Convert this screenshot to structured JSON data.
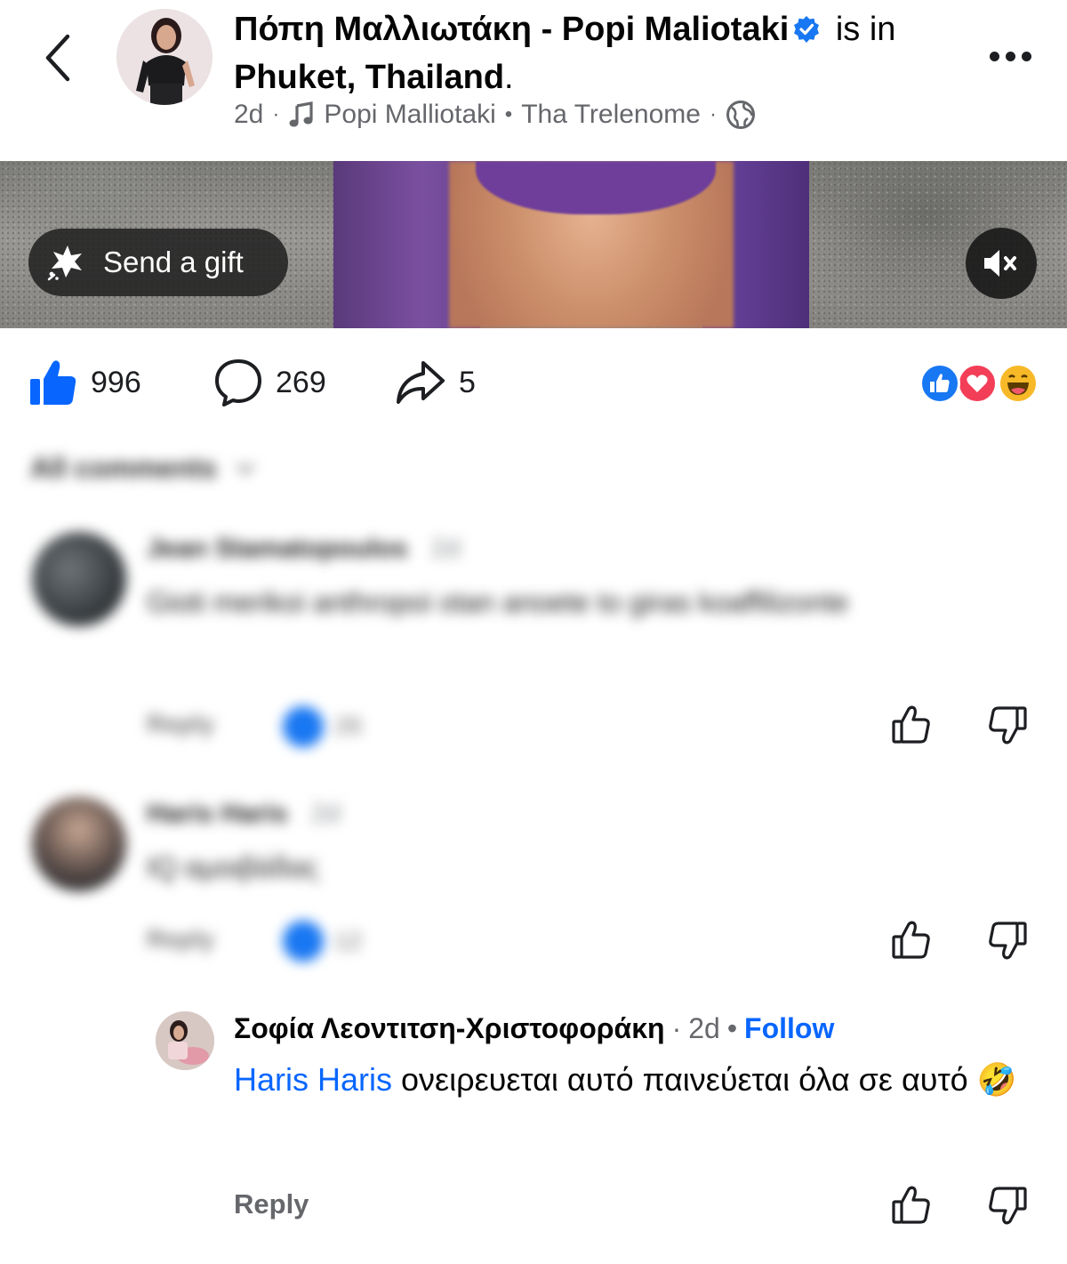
{
  "header": {
    "author_greek": "Πόπη Μαλλιωτάκη",
    "author_separator": "-",
    "author_latin": "Popi Maliotaki",
    "is_in": "is in",
    "location": "Phuket, Thailand",
    "period": ".",
    "time": "2d",
    "song_artist": "Popi Malliotaki",
    "song_title": "Tha Trelenome",
    "meta_dot": "·",
    "song_dot": "•"
  },
  "media": {
    "gift_label": "Send a gift"
  },
  "actions": {
    "likes": "996",
    "comments": "269",
    "shares": "5"
  },
  "comments_filter": {
    "label": "All comments"
  },
  "comments": [
    {
      "name": "Jean Stamatopoulos",
      "time": "2d",
      "text": "Gioti merikoi anthropoi otan anoete to giras koaffilizonte",
      "reply_label": "Reply",
      "like_count": "26"
    },
    {
      "name": "Haris Haris",
      "time": "2d",
      "text": "IQ αμοιβάδας",
      "reply_label": "Reply",
      "like_count": "12"
    }
  ],
  "reply": {
    "name": "Σοφία Λεοντιτση-Χριστοφοράκη",
    "dot": "·",
    "time": "2d",
    "dot2": "•",
    "follow_label": "Follow",
    "mention": "Haris Haris",
    "text": "ονειρευεται αυτό παινεύεται όλα σε αυτό",
    "emoji": "🤣",
    "reply_label": "Reply"
  },
  "colors": {
    "brand_blue": "#0866ff",
    "like_blue": "#1877f2",
    "love_red": "#f33e58",
    "haha_yellow": "#f7b928",
    "secondary_text": "#65676b"
  },
  "icons": [
    "back-arrow-icon",
    "verified-badge-icon",
    "music-note-icon",
    "globe-icon",
    "more-dots-icon",
    "gift-icon",
    "mute-icon",
    "like-icon",
    "comment-icon",
    "share-icon",
    "thumbs-up-icon",
    "thumbs-down-icon"
  ]
}
